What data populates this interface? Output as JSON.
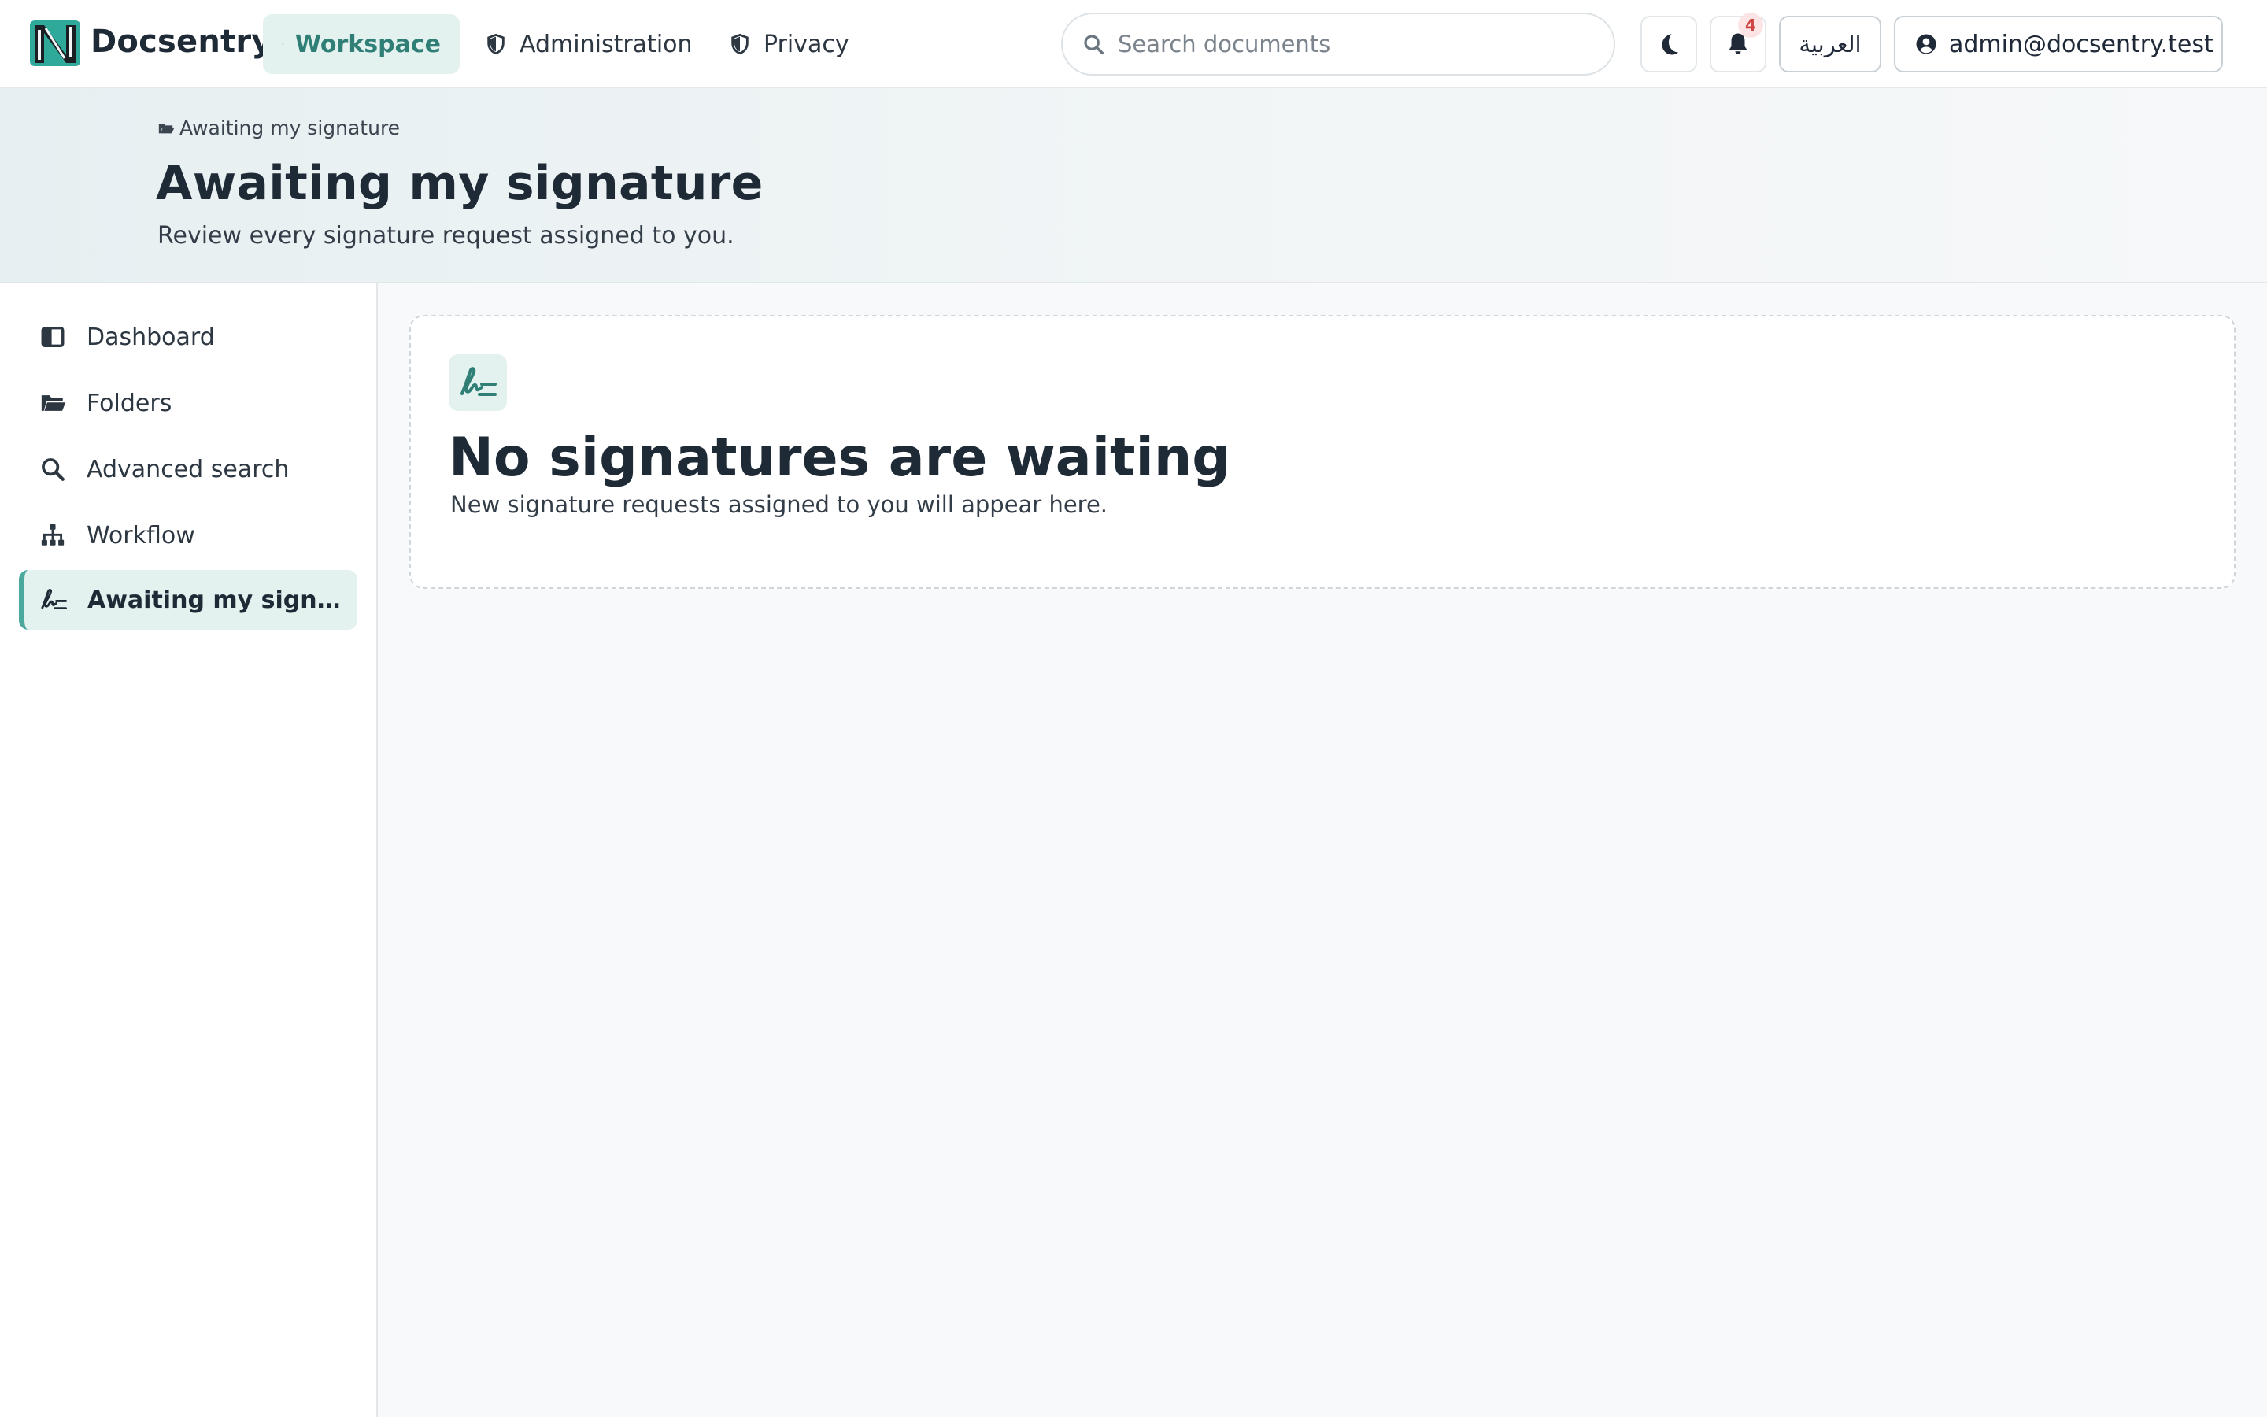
{
  "app": {
    "brand": "Docsentry"
  },
  "topnav": {
    "items": [
      {
        "label": "Workspace",
        "icon": "columns-icon",
        "active": true
      },
      {
        "label": "Administration",
        "icon": "shield-icon",
        "active": false
      },
      {
        "label": "Privacy",
        "icon": "shield-icon",
        "active": false
      }
    ]
  },
  "search": {
    "placeholder": "Search documents",
    "value": ""
  },
  "actions": {
    "theme_icon": "moon-icon",
    "notifications_icon": "bell-icon",
    "notification_count": "4",
    "language_label": "العربية",
    "user_label": "admin@docsentry.test"
  },
  "header": {
    "breadcrumb": "Awaiting my signature",
    "title": "Awaiting my signature",
    "subtitle": "Review every signature request assigned to you."
  },
  "sidebar": {
    "items": [
      {
        "label": "Dashboard",
        "icon": "dashboard-icon",
        "active": false
      },
      {
        "label": "Folders",
        "icon": "folder-icon",
        "active": false
      },
      {
        "label": "Advanced search",
        "icon": "search-icon",
        "active": false
      },
      {
        "label": "Workflow",
        "icon": "sitemap-icon",
        "active": false
      },
      {
        "label": "Awaiting my signature",
        "icon": "signature-icon",
        "active": true
      }
    ]
  },
  "empty_state": {
    "icon": "signature-icon",
    "title": "No signatures are waiting",
    "message": "New signature requests assigned to you will appear here."
  },
  "colors": {
    "accent": "#4aa89c",
    "accent_bg": "#e3f1ef",
    "accent_text": "#2f7f76",
    "badge": "#d14343"
  }
}
